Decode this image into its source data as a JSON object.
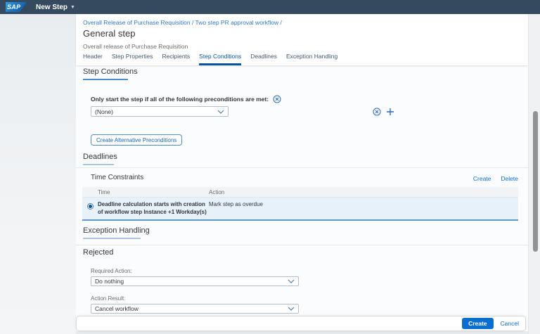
{
  "topbar": {
    "logo_text": "SAP",
    "app_title": "New Step"
  },
  "page_header": {
    "breadcrumb": {
      "link1": "Overall Release of Purchase Requisition",
      "sep1": " / ",
      "link2": "Two step PR approval workflow",
      "sep2": " /"
    },
    "title": "General step",
    "subtitle": "Overall release of Purchase Requisition",
    "tabs": [
      {
        "label": "Header",
        "active": false
      },
      {
        "label": "Step Properties",
        "active": false
      },
      {
        "label": "Recipients",
        "active": false
      },
      {
        "label": "Step Conditions",
        "active": true
      },
      {
        "label": "Deadlines",
        "active": false
      },
      {
        "label": "Exception Handling",
        "active": false
      }
    ]
  },
  "step_conditions": {
    "heading": "Step Conditions",
    "precondition_label": "Only start the step if all of the following preconditions are met:",
    "condition_dropdown_value": "(None)",
    "create_alternative_button": "Create Alternative Preconditions"
  },
  "deadlines": {
    "heading": "Deadlines",
    "panel_title": "Time Constraints",
    "create_link": "Create",
    "delete_link": "Delete",
    "table": {
      "columns": [
        "Time",
        "Action"
      ],
      "rows": [
        {
          "selected": true,
          "time": "Deadline calculation starts with creation of workflow step Instance +1 Workday(s)",
          "action": "Mark step as overdue"
        }
      ]
    }
  },
  "exception_handling": {
    "heading": "Exception Handling",
    "rejected_heading": "Rejected",
    "required_action_label": "Required Action:",
    "required_action_value": "Do nothing",
    "action_result_label": "Action Result:",
    "action_result_value": "Cancel workflow"
  },
  "footer": {
    "create_label": "Create",
    "cancel_label": "Cancel"
  },
  "colors": {
    "shell_bar": "#354a5f",
    "accent_blue": "#0a6ed1",
    "active_tab": "#0854a0",
    "selected_row_bg": "#e7f1fa",
    "selected_row_border": "#5e97c8",
    "section_underline_active": "#4d90cf",
    "section_underline": "#a8c6e4"
  }
}
